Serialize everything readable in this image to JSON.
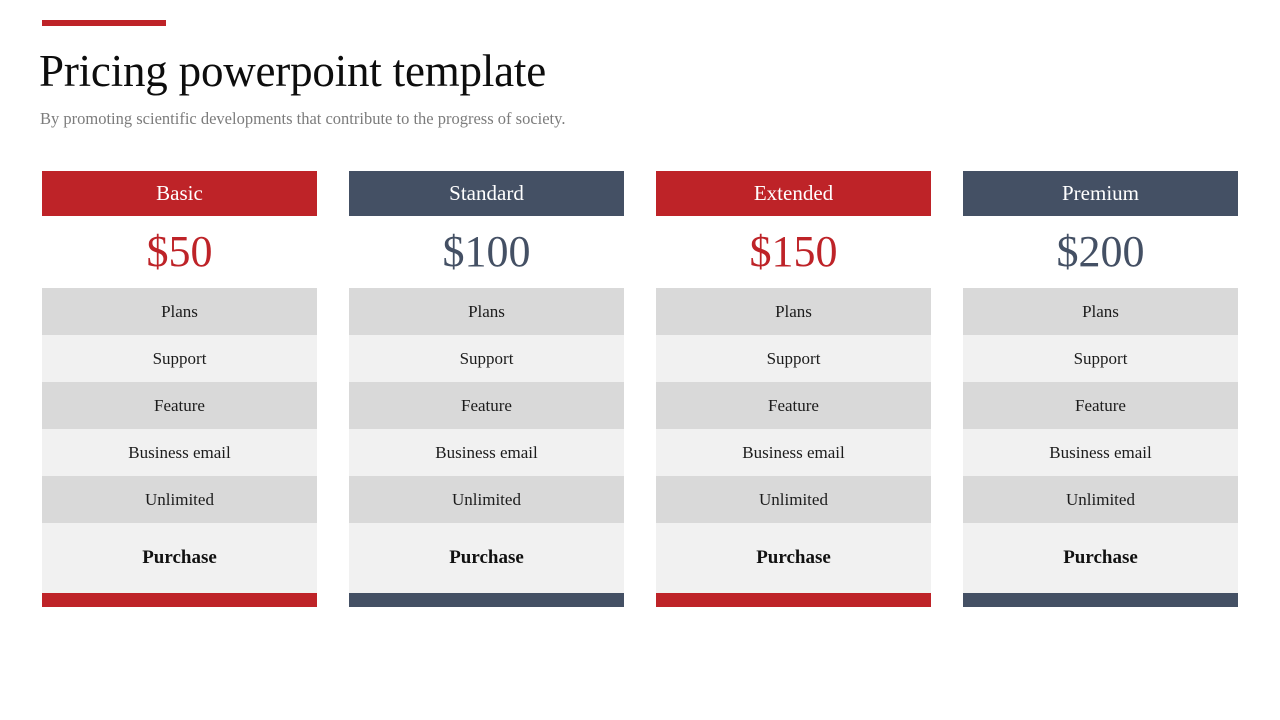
{
  "header": {
    "title": "Pricing powerpoint template",
    "subtitle": "By promoting scientific developments that contribute to the progress of society.",
    "accent_color": "#be2328"
  },
  "theme": {
    "red": "#be2328",
    "blue": "#445064",
    "row_shade_dark": "#d9d9d9",
    "row_shade_light": "#f1f1f1",
    "cta_background": "#f1f1f1",
    "title_color": "#0d0d0d",
    "subtitle_color": "#7c7c7c"
  },
  "plans": [
    {
      "name": "Basic",
      "price": "$50",
      "color": "#be2328",
      "cta_label": "Purchase",
      "features": [
        "Plans",
        "Support",
        "Feature",
        "Business email",
        "Unlimited"
      ]
    },
    {
      "name": "Standard",
      "price": "$100",
      "color": "#445064",
      "cta_label": "Purchase",
      "features": [
        "Plans",
        "Support",
        "Feature",
        "Business email",
        "Unlimited"
      ]
    },
    {
      "name": "Extended",
      "price": "$150",
      "color": "#be2328",
      "cta_label": "Purchase",
      "features": [
        "Plans",
        "Support",
        "Feature",
        "Business email",
        "Unlimited"
      ]
    },
    {
      "name": "Premium",
      "price": "$200",
      "color": "#445064",
      "cta_label": "Purchase",
      "features": [
        "Plans",
        "Support",
        "Feature",
        "Business email",
        "Unlimited"
      ]
    }
  ]
}
